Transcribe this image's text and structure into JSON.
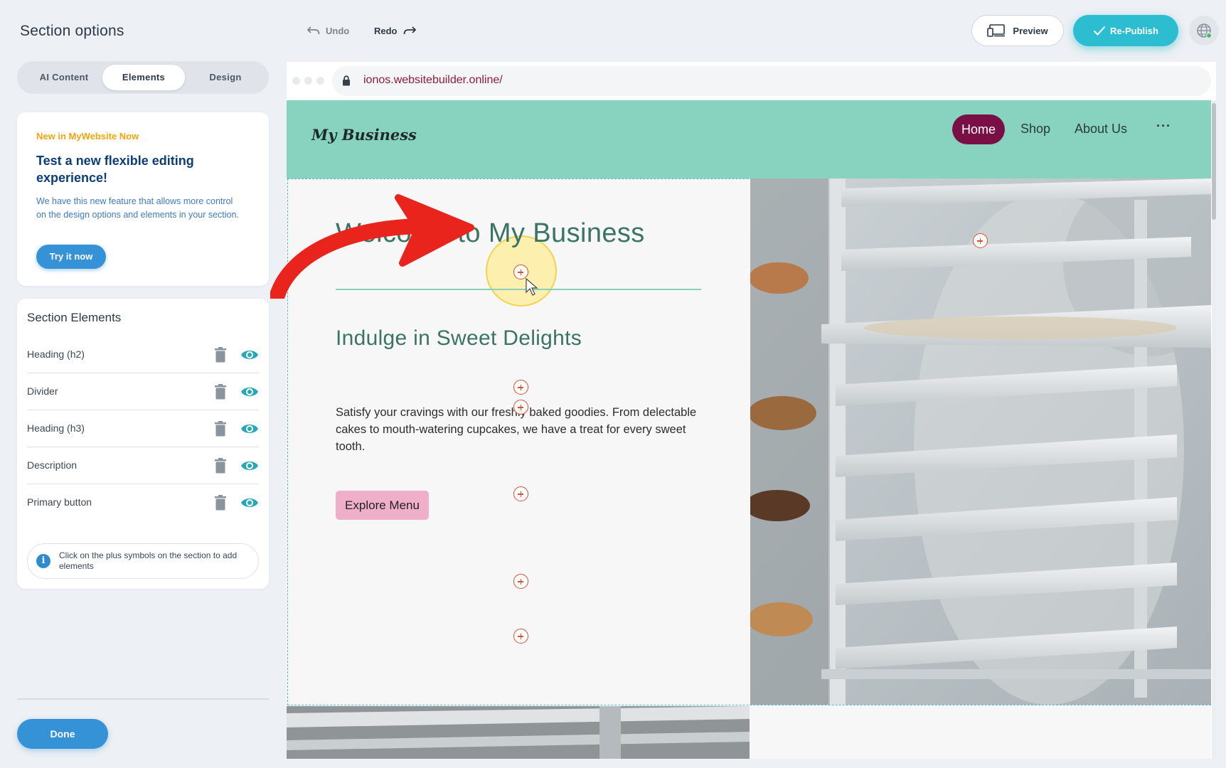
{
  "left_panel": {
    "title": "Section options",
    "tabs": [
      {
        "label": "AI Content"
      },
      {
        "label": "Elements"
      },
      {
        "label": "Design"
      }
    ],
    "promo": {
      "kicker": "New in MyWebsite Now",
      "title": "Test a new flexible editing experience!",
      "text": "We have this new feature that allows more control on the design options and elements in your section.",
      "button": "Try it now"
    },
    "section_elements": {
      "title": "Section Elements",
      "items": [
        {
          "label": "Heading (h2)"
        },
        {
          "label": "Divider"
        },
        {
          "label": "Heading (h3)"
        },
        {
          "label": "Description"
        },
        {
          "label": "Primary button"
        }
      ],
      "hint": "Click on the plus symbols on the section to add elements"
    },
    "done_button": "Done"
  },
  "toolbar": {
    "undo": "Undo",
    "redo": "Redo",
    "preview": "Preview",
    "publish": "Re-Publish"
  },
  "browser": {
    "url": "ionos.websitebuilder.online/"
  },
  "site": {
    "logo": "My Business",
    "nav": [
      {
        "label": "Home"
      },
      {
        "label": "Shop"
      },
      {
        "label": "About Us"
      },
      {
        "label": "···"
      }
    ],
    "heading": "Welcome to My Business",
    "subheading": "Indulge in Sweet Delights",
    "description": "Satisfy your cravings with our freshly baked goodies. From delectable cakes to mouth-watering cupcakes, we have a treat for every sweet tooth.",
    "cta": "Explore Menu"
  },
  "colors": {
    "accent": "#3592d7",
    "publish": "#2cbdd0",
    "site_nav": "#88d3bf",
    "home_pill": "#7a0f45",
    "heading": "#3b7465",
    "cta": "#f0afc8",
    "plus": "#d8502d",
    "arrow": "#e8241c"
  }
}
